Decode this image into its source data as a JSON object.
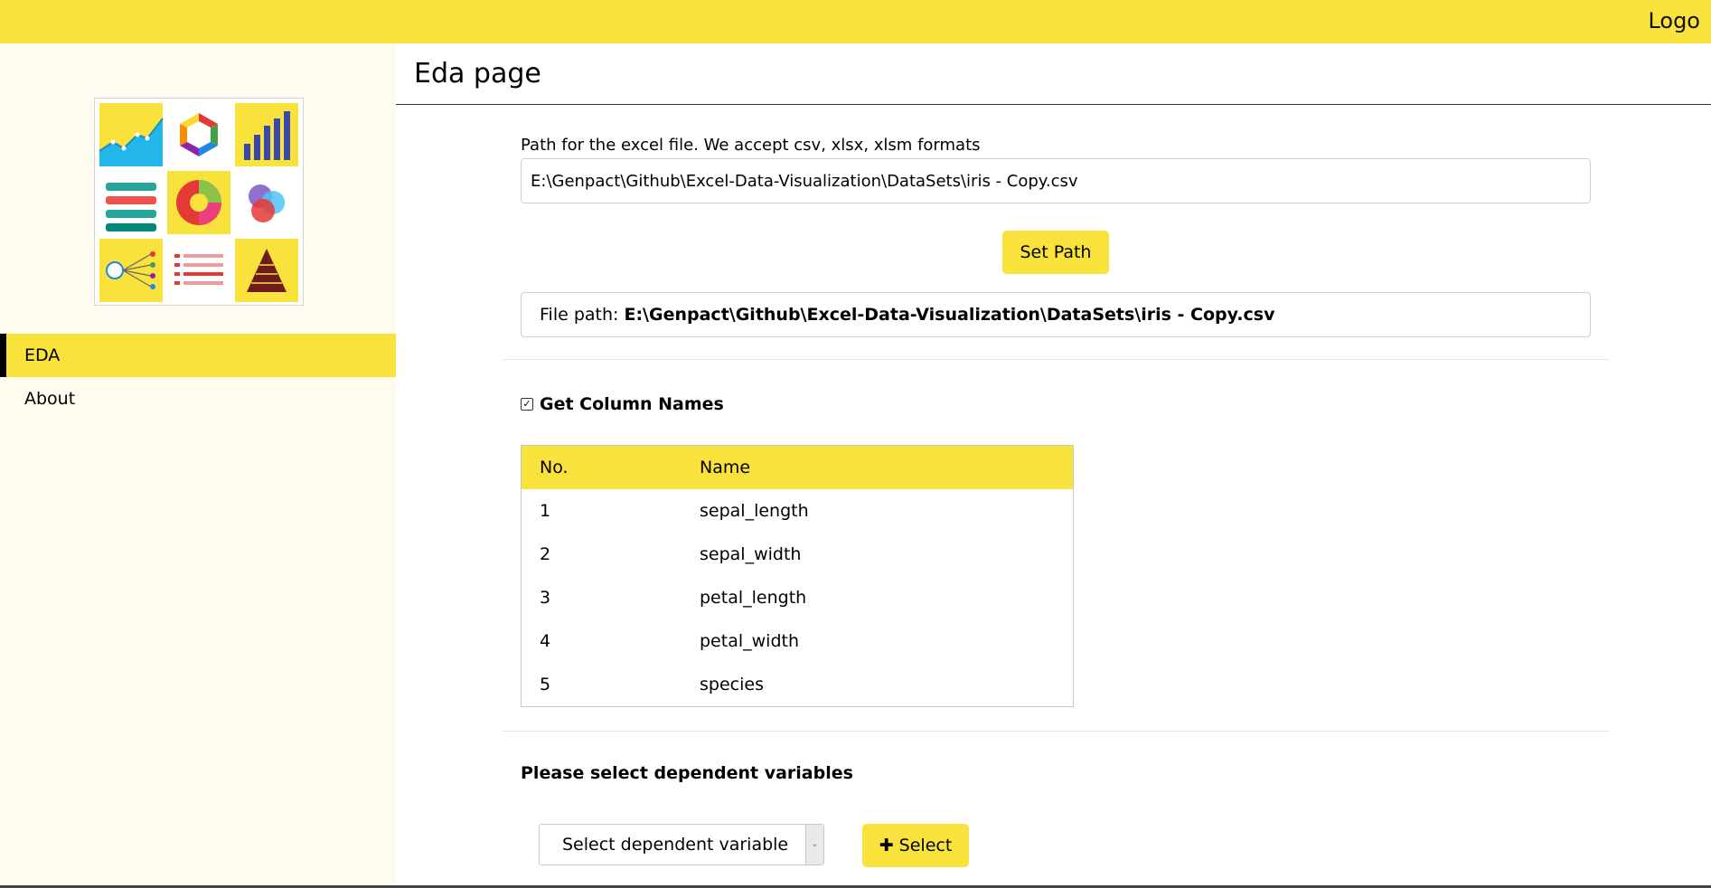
{
  "header": {
    "logo_text": "Logo",
    "bar_color": "#f9e23c"
  },
  "sidebar": {
    "app_logo_icon": "data-visualization-icons-logo",
    "items": [
      {
        "label": "EDA",
        "active": true
      },
      {
        "label": "About",
        "active": false
      }
    ]
  },
  "main": {
    "title": "Eda page",
    "path_label": "Path for the excel file. We accept csv, xlsx, xlsm formats",
    "path_value": "E:\\Genpact\\Github\\Excel-Data-Visualization\\DataSets\\iris - Copy.csv",
    "set_path_label": "Set Path",
    "file_path_prefix": "File path:",
    "file_path_value": "E:\\Genpact\\Github\\Excel-Data-Visualization\\DataSets\\iris - Copy.csv",
    "get_columns_label": "Get Column Names",
    "get_columns_checked": true,
    "columns_table": {
      "headers": [
        "No.",
        "Name"
      ],
      "rows": [
        [
          "1",
          "sepal_length"
        ],
        [
          "2",
          "sepal_width"
        ],
        [
          "3",
          "petal_length"
        ],
        [
          "4",
          "petal_width"
        ],
        [
          "5",
          "species"
        ]
      ]
    },
    "dependent_label": "Please select dependent variables",
    "dependent_select_value": "Select dependent variable",
    "select_button_label": "Select",
    "select_button_icon": "plus-icon"
  }
}
